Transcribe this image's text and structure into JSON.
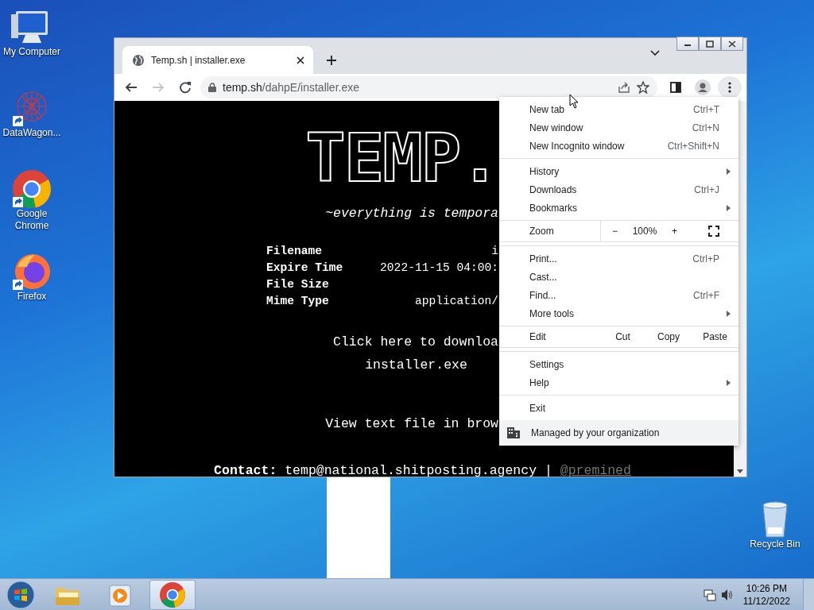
{
  "desktop_icons": [
    {
      "kind": "computer",
      "label": "My Computer"
    },
    {
      "kind": "starburst",
      "label": "DataWagon..."
    },
    {
      "kind": "chrome",
      "label": "Google Chrome"
    },
    {
      "kind": "firefox",
      "label": "Firefox"
    }
  ],
  "recycle_bin": {
    "label": "Recycle Bin"
  },
  "browser": {
    "tab": {
      "title": "Temp.sh | installer.exe",
      "selected": true
    },
    "nav_buttons": [
      {
        "kind": "back",
        "disabled": false
      },
      {
        "kind": "forward",
        "disabled": true
      },
      {
        "kind": "reload",
        "disabled": false
      }
    ],
    "url": {
      "host": "temp.sh",
      "path": "/dahpE/installer.exe"
    },
    "page": {
      "logo": "TEMP.",
      "tagline": "~everything is tempora",
      "fields": [
        {
          "label": "Filename",
          "value": "i"
        },
        {
          "label": "Expire Time",
          "value": "2022-11-15 04:00:"
        },
        {
          "label": "File Size"
        },
        {
          "label": "Mime Type",
          "value": "application/"
        }
      ],
      "download_link": "Click here to downloa",
      "file_link": "installer.exe",
      "view_link": "View text file in brow",
      "contact_label": "Contact:",
      "contact_email": "temp@national.shitposting.agency",
      "contact_separator": "|",
      "contact_handle": "@premined"
    }
  },
  "menu": {
    "groups": [
      [
        {
          "kind": "item",
          "label": "New tab",
          "shortcut": "Ctrl+T",
          "submenu": false
        },
        {
          "kind": "item",
          "label": "New window",
          "shortcut": "Ctrl+N",
          "submenu": false
        },
        {
          "kind": "item",
          "label": "New Incognito window",
          "shortcut": "Ctrl+Shift+N",
          "submenu": false
        }
      ],
      [
        {
          "kind": "item",
          "label": "History",
          "submenu": true
        },
        {
          "kind": "item",
          "label": "Downloads",
          "shortcut": "Ctrl+J",
          "submenu": false
        },
        {
          "kind": "item",
          "label": "Bookmarks",
          "submenu": true
        }
      ],
      [
        {
          "kind": "zoom",
          "label": "Zoom",
          "minus": "−",
          "value": "100%",
          "plus": "+"
        }
      ],
      [
        {
          "kind": "item",
          "label": "Print...",
          "shortcut": "Ctrl+P",
          "submenu": false
        },
        {
          "kind": "item",
          "label": "Cast...",
          "submenu": false
        },
        {
          "kind": "item",
          "label": "Find...",
          "shortcut": "Ctrl+F",
          "submenu": false
        },
        {
          "kind": "item",
          "label": "More tools",
          "submenu": true
        }
      ],
      [
        {
          "kind": "edit",
          "label": "Edit",
          "buttons": [
            "Cut",
            "Copy",
            "Paste"
          ]
        }
      ],
      [
        {
          "kind": "item",
          "label": "Settings",
          "submenu": false
        },
        {
          "kind": "item",
          "label": "Help",
          "submenu": true
        }
      ],
      [
        {
          "kind": "item",
          "label": "Exit",
          "submenu": false
        }
      ],
      [
        {
          "kind": "managed",
          "label": "Managed by your organization"
        }
      ]
    ]
  },
  "taskbar": {
    "apps": [
      {
        "kind": "explorer",
        "selected": false
      },
      {
        "kind": "media",
        "selected": false
      },
      {
        "kind": "chrome",
        "selected": true
      }
    ],
    "time": "10:26 PM",
    "date": "11/12/2022"
  }
}
